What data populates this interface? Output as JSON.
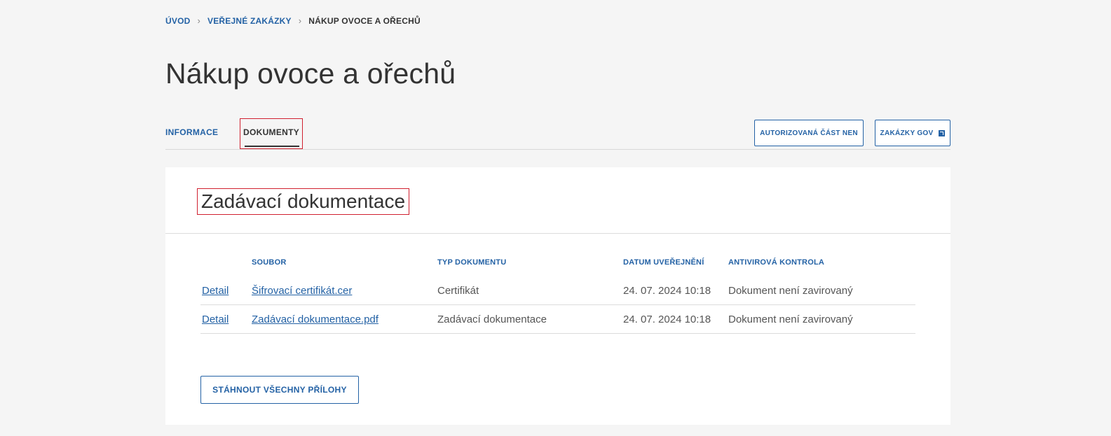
{
  "breadcrumb": {
    "items": [
      "ÚVOD",
      "VEŘEJNÉ ZAKÁZKY"
    ],
    "current": "NÁKUP OVOCE A OŘECHŮ"
  },
  "page_title": "Nákup ovoce a ořechů",
  "tabs": [
    {
      "label": "INFORMACE",
      "active": false
    },
    {
      "label": "DOKUMENTY",
      "active": true
    }
  ],
  "header_buttons": {
    "autorizovana": "AUTORIZOVANÁ ČÁST NEN",
    "zakazky_gov": "ZAKÁZKY GOV"
  },
  "section": {
    "title": "Zadávací dokumentace",
    "table": {
      "headers": [
        "",
        "SOUBOR",
        "TYP DOKUMENTU",
        "DATUM UVEŘEJNĚNÍ",
        "ANTIVIROVÁ KONTROLA"
      ],
      "rows": [
        {
          "detail": "Detail",
          "file": "Šifrovací certifikát.cer",
          "type": "Certifikát",
          "date": "24. 07. 2024 10:18",
          "av": "Dokument není zavirovaný"
        },
        {
          "detail": "Detail",
          "file": "Zadávací dokumentace.pdf",
          "type": "Zadávací dokumentace",
          "date": "24. 07. 2024 10:18",
          "av": "Dokument není zavirovaný"
        }
      ]
    },
    "download_button": "STÁHNOUT VŠECHNY PŘÍLOHY"
  },
  "colors": {
    "accent": "#2462a5",
    "highlight": "#d0202f",
    "background": "#f5f5f5"
  }
}
